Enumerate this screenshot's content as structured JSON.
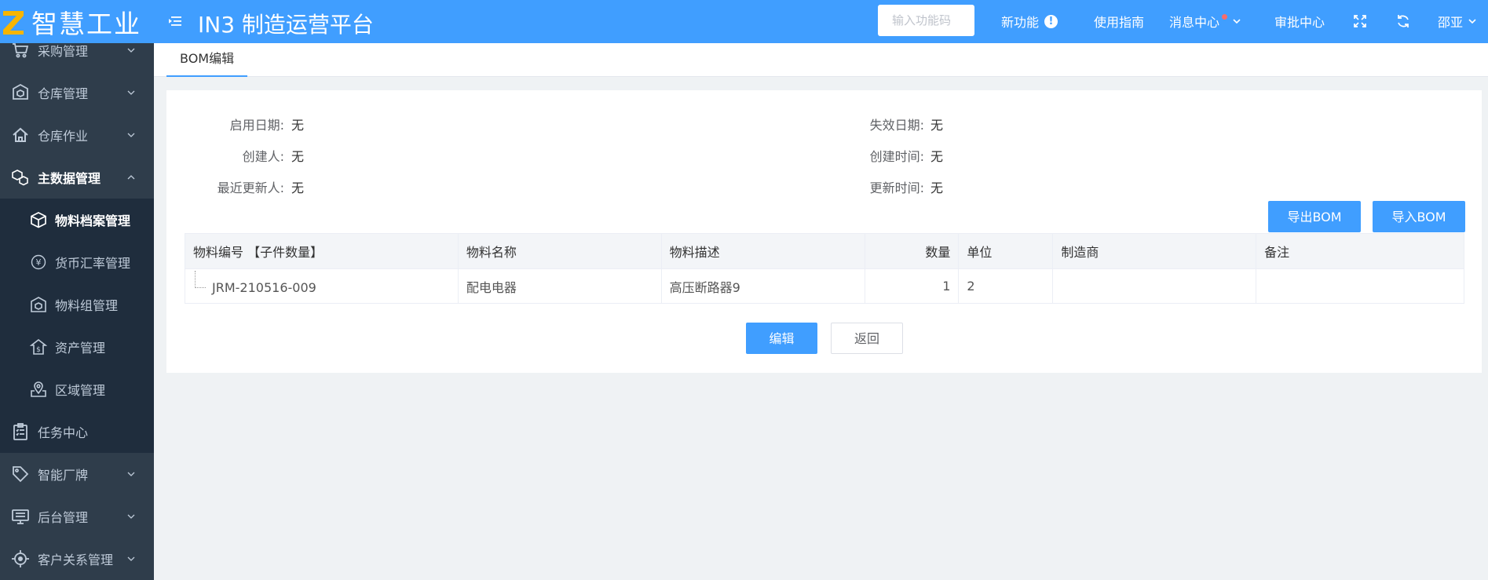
{
  "header": {
    "brand": "智慧工业",
    "app_title": "IN3 制造运营平台",
    "search_placeholder": "输入功能码",
    "new_feature": "新功能",
    "new_feature_badge": "!",
    "guide": "使用指南",
    "messages": "消息中心",
    "approval": "审批中心",
    "user": "邵亚"
  },
  "sidebar": {
    "items": [
      {
        "label": "采购管理",
        "icon": "cart-icon"
      },
      {
        "label": "仓库管理",
        "icon": "warehouse-icon"
      },
      {
        "label": "仓库作业",
        "icon": "home-icon"
      },
      {
        "label": "主数据管理",
        "icon": "cubes-icon"
      },
      {
        "label": "任务中心",
        "icon": "clipboard-icon"
      },
      {
        "label": "智能厂牌",
        "icon": "tag-icon"
      },
      {
        "label": "后台管理",
        "icon": "monitor-icon"
      },
      {
        "label": "客户关系管理",
        "icon": "target-icon"
      }
    ],
    "sub_items": [
      {
        "label": "物料档案管理",
        "icon": "box-icon"
      },
      {
        "label": "货币汇率管理",
        "icon": "currency-icon"
      },
      {
        "label": "物料组管理",
        "icon": "warehouse-icon"
      },
      {
        "label": "资产管理",
        "icon": "house-dollar-icon"
      },
      {
        "label": "区域管理",
        "icon": "map-pin-icon"
      }
    ]
  },
  "tabs": [
    {
      "label": "BOM编辑"
    }
  ],
  "form": {
    "start_date_label": "启用日期:",
    "start_date_value": "无",
    "expire_date_label": "失效日期:",
    "expire_date_value": "无",
    "creator_label": "创建人:",
    "creator_value": "无",
    "created_time_label": "创建时间:",
    "created_time_value": "无",
    "updater_label": "最近更新人:",
    "updater_value": "无",
    "updated_time_label": "更新时间:",
    "updated_time_value": "无"
  },
  "actions": {
    "export_bom": "导出BOM",
    "import_bom": "导入BOM",
    "edit": "编辑",
    "back": "返回"
  },
  "table": {
    "columns": [
      "物料编号 【子件数量】",
      "物料名称",
      "物料描述",
      "数量",
      "单位",
      "制造商",
      "备注"
    ],
    "rows": [
      {
        "code": "JRM-210516-009",
        "name": "配电电器",
        "desc": "高压断路器9",
        "qty": "1",
        "unit": "2",
        "maker": "",
        "note": ""
      }
    ]
  },
  "colors": {
    "primary": "#409eff",
    "sidebar_bg": "#2f3d4b",
    "submenu_bg": "#1f2d3d",
    "content_bg": "#eff2f4"
  }
}
